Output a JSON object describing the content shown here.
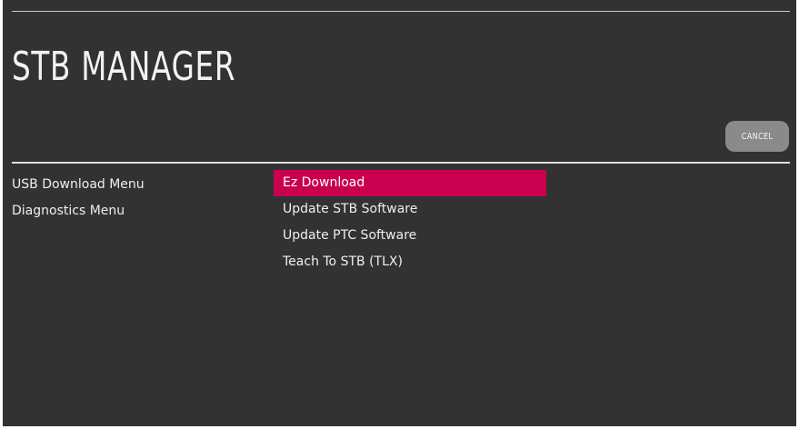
{
  "app": {
    "title": "STB MANAGER"
  },
  "actions": {
    "cancel_label": "CANCEL"
  },
  "left_menu": {
    "items": [
      {
        "label": "USB Download Menu",
        "active": true
      },
      {
        "label": "Diagnostics Menu",
        "active": false
      }
    ]
  },
  "submenu": {
    "selected_index": 0,
    "items": [
      {
        "label": "Ez Download"
      },
      {
        "label": "Update STB Software"
      },
      {
        "label": "Update PTC Software"
      },
      {
        "label": "Teach To STB (TLX)"
      }
    ]
  },
  "colors": {
    "background": "#333232",
    "highlight": "#c8004f",
    "button": "#8a8a8a",
    "text": "#efefef"
  }
}
